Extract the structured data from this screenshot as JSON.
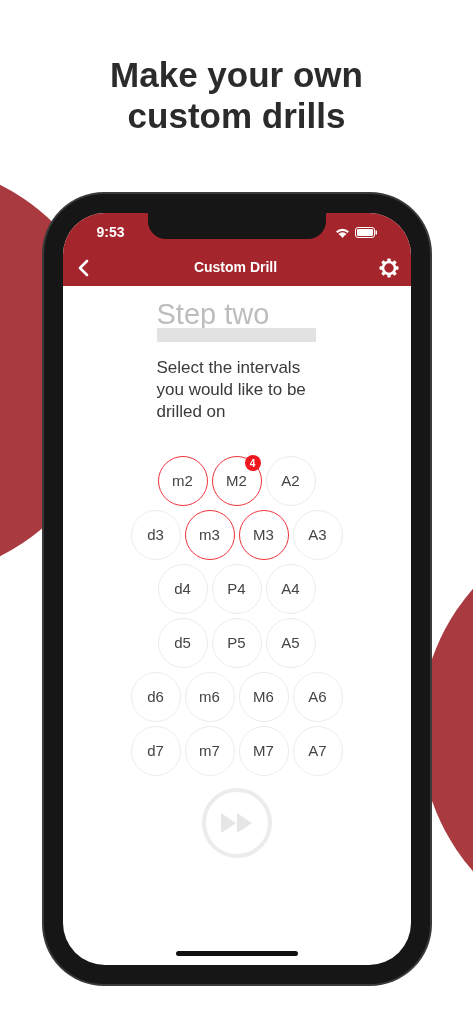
{
  "headline": "Make your own custom drills",
  "status_bar": {
    "time": "9:53"
  },
  "nav": {
    "title": "Custom Drill"
  },
  "step_title": "Step two",
  "instruction": "Select the intervals you would like to be drilled on",
  "interval_rows": [
    [
      {
        "label": "m2",
        "selected": true
      },
      {
        "label": "M2",
        "selected": true,
        "badge": "4"
      },
      {
        "label": "A2",
        "selected": false
      }
    ],
    [
      {
        "label": "d3",
        "selected": false
      },
      {
        "label": "m3",
        "selected": true
      },
      {
        "label": "M3",
        "selected": true
      },
      {
        "label": "A3",
        "selected": false
      }
    ],
    [
      {
        "label": "d4",
        "selected": false
      },
      {
        "label": "P4",
        "selected": false
      },
      {
        "label": "A4",
        "selected": false
      }
    ],
    [
      {
        "label": "d5",
        "selected": false
      },
      {
        "label": "P5",
        "selected": false
      },
      {
        "label": "A5",
        "selected": false
      }
    ],
    [
      {
        "label": "d6",
        "selected": false
      },
      {
        "label": "m6",
        "selected": false
      },
      {
        "label": "M6",
        "selected": false
      },
      {
        "label": "A6",
        "selected": false
      }
    ],
    [
      {
        "label": "d7",
        "selected": false
      },
      {
        "label": "m7",
        "selected": false
      },
      {
        "label": "M7",
        "selected": false
      },
      {
        "label": "A7",
        "selected": false
      }
    ]
  ],
  "next_button": {
    "disabled": true
  }
}
